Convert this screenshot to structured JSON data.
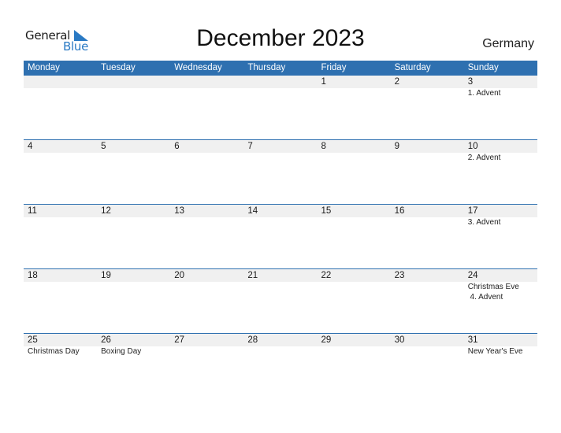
{
  "logo": {
    "line1": "General",
    "line2": "Blue"
  },
  "title": "December 2023",
  "country": "Germany",
  "colors": {
    "header_bg": "#2e70b0",
    "date_bar_bg": "#f0f0f0",
    "logo_blue": "#2a7ac4"
  },
  "weekdays": [
    "Monday",
    "Tuesday",
    "Wednesday",
    "Thursday",
    "Friday",
    "Saturday",
    "Sunday"
  ],
  "weeks": [
    {
      "days": [
        "",
        "",
        "",
        "",
        "1",
        "2",
        "3"
      ],
      "events": [
        [],
        [],
        [],
        [],
        [],
        [],
        [
          "1. Advent"
        ]
      ]
    },
    {
      "days": [
        "4",
        "5",
        "6",
        "7",
        "8",
        "9",
        "10"
      ],
      "events": [
        [],
        [],
        [],
        [],
        [],
        [],
        [
          "2. Advent"
        ]
      ]
    },
    {
      "days": [
        "11",
        "12",
        "13",
        "14",
        "15",
        "16",
        "17"
      ],
      "events": [
        [],
        [],
        [],
        [],
        [],
        [],
        [
          "3. Advent"
        ]
      ]
    },
    {
      "days": [
        "18",
        "19",
        "20",
        "21",
        "22",
        "23",
        "24"
      ],
      "events": [
        [],
        [],
        [],
        [],
        [],
        [],
        [
          "Christmas Eve",
          " 4. Advent"
        ]
      ]
    },
    {
      "days": [
        "25",
        "26",
        "27",
        "28",
        "29",
        "30",
        "31"
      ],
      "events": [
        [
          "Christmas Day"
        ],
        [
          "Boxing Day"
        ],
        [],
        [],
        [],
        [],
        [
          "New Year's Eve"
        ]
      ]
    }
  ]
}
